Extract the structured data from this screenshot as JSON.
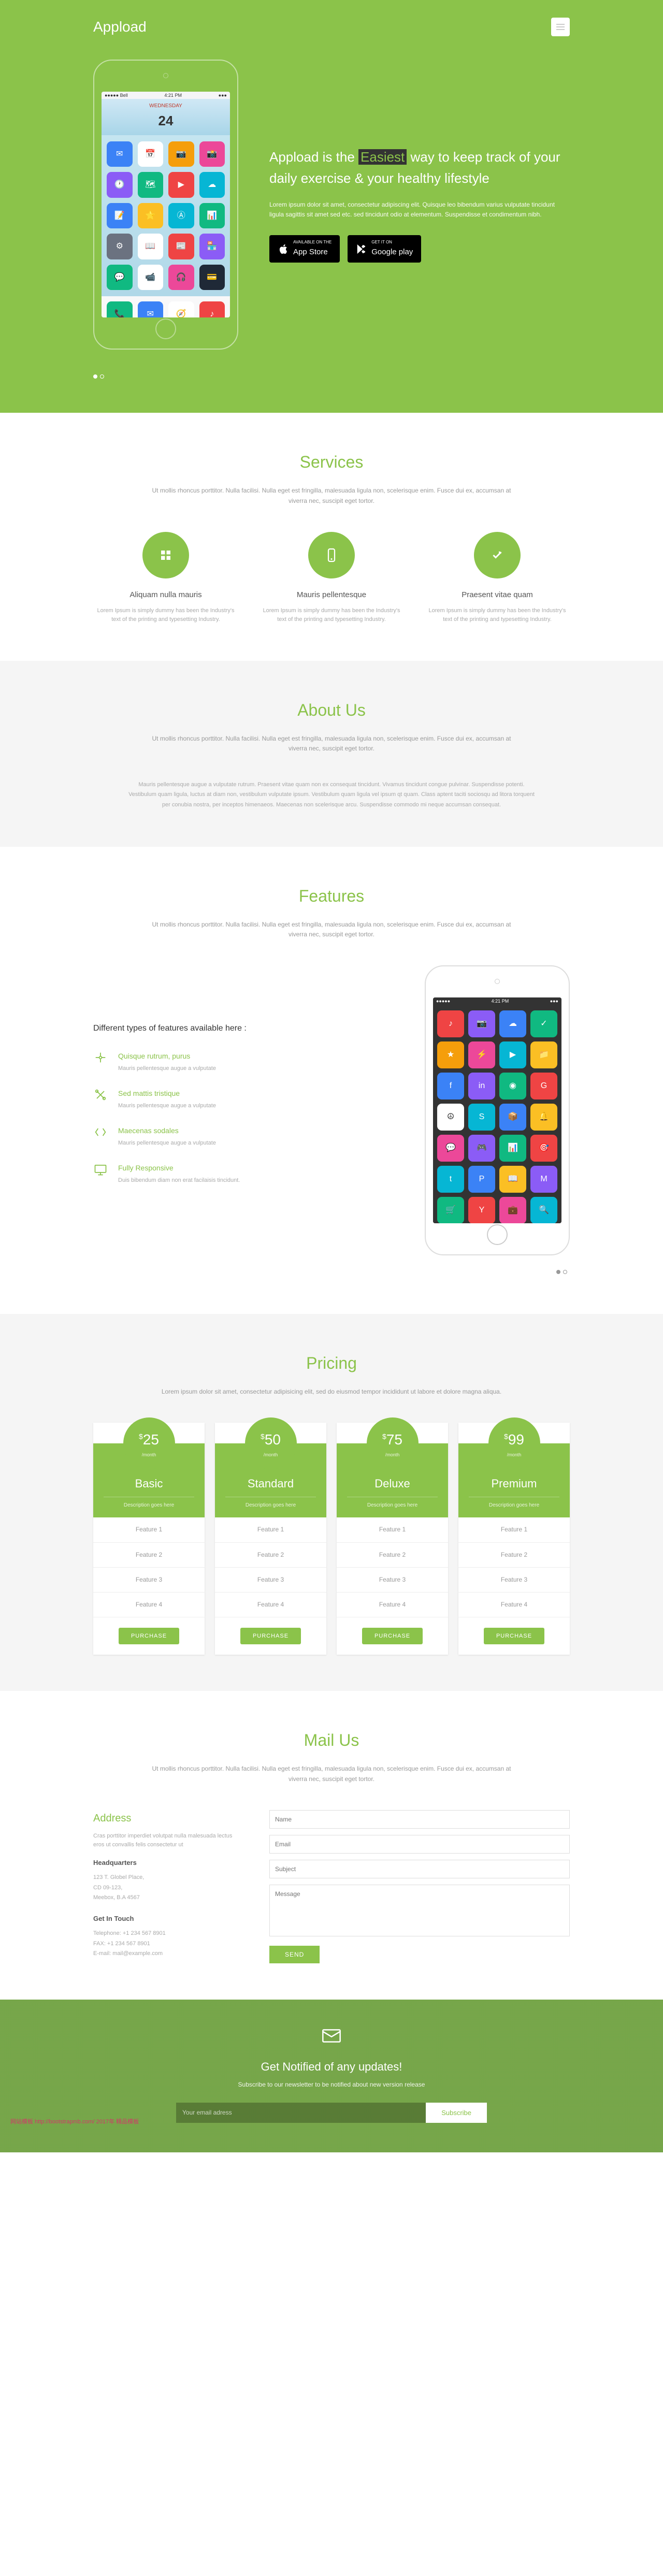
{
  "nav": {
    "logo": "Appload"
  },
  "hero": {
    "title_pre": "Appload is the ",
    "title_em": "Easiest",
    "title_post": " way to keep track of your daily exercise & your healthy lifestyle",
    "desc": "Lorem ipsum dolor sit amet, consectetur adipiscing elit. Quisque leo bibendum varius vulputate tincidunt ligula sagittis sit amet sed etc. sed tincidunt odio at elementum. Suspendisse et condimentum nibh.",
    "appstore_small": "AVAILABLE ON THE",
    "appstore_big": "App Store",
    "play_small": "GET IT ON",
    "play_big": "Google play",
    "phone": {
      "carrier": "●●●●● Bell",
      "time": "4:21 PM",
      "day": "WEDNESDAY",
      "date": "24"
    }
  },
  "services": {
    "title": "Services",
    "sub": "Ut mollis rhoncus porttitor. Nulla facilisi. Nulla eget est fringilla, malesuada ligula non, scelerisque enim. Fusce dui ex, accumsan at viverra nec, suscipit eget tortor.",
    "items": [
      {
        "title": "Aliquam nulla mauris",
        "desc": "Lorem Ipsum is simply dummy has been the Industry's text of the printing and typesetting Industry."
      },
      {
        "title": "Mauris pellentesque",
        "desc": "Lorem Ipsum is simply dummy has been the Industry's text of the printing and typesetting Industry."
      },
      {
        "title": "Praesent vitae quam",
        "desc": "Lorem Ipsum is simply dummy has been the Industry's text of the printing and typesetting Industry."
      }
    ]
  },
  "about": {
    "title": "About Us",
    "sub": "Ut mollis rhoncus porttitor. Nulla facilisi. Nulla eget est fringilla, malesuada ligula non, scelerisque enim. Fusce dui ex, accumsan at viverra nec, suscipit eget tortor.",
    "body": "Mauris pellentesque augue a vulputate rutrum. Praesent vitae quam non ex consequat tincidunt. Vivamus tincidunt congue pulvinar. Suspendisse potenti. Vestibulum quam ligula, luctus at diam non, vestibulum vulputate ipsum. Vestibulum quam ligula vel ipsum qt quam. Class aptent taciti sociosqu ad litora torquent per conubia nostra, per inceptos himenaeos. Maecenas non scelerisque arcu. Suspendisse commodo mi neque accumsan consequat."
  },
  "features": {
    "title": "Features",
    "sub": "Ut mollis rhoncus porttitor. Nulla facilisi. Nulla eget est fringilla, malesuada ligula non, scelerisque enim. Fusce dui ex, accumsan at viverra nec, suscipit eget tortor.",
    "heading": "Different types of features available here :",
    "items": [
      {
        "title": "Quisque rutrum, purus",
        "desc": "Mauris pellentesque augue a vulputate"
      },
      {
        "title": "Sed mattis tristique",
        "desc": "Mauris pellentesque augue a vulputate"
      },
      {
        "title": "Maecenas sodales",
        "desc": "Mauris pellentesque augue a vulputate"
      },
      {
        "title": "Fully Responsive",
        "desc": "Duis bibendum diam non erat facilaisis tincidunt."
      }
    ]
  },
  "pricing": {
    "title": "Pricing",
    "sub": "Lorem ipsum dolor sit amet, consectetur adipisicing elit, sed do eiusmod tempor incididunt ut labore et dolore magna aliqua.",
    "plan_desc": "Description goes here",
    "purchase": "PURCHASE",
    "plans": [
      {
        "price": "25",
        "per": "/month",
        "name": "Basic",
        "features": [
          "Feature 1",
          "Feature 2",
          "Feature 3",
          "Feature 4"
        ]
      },
      {
        "price": "50",
        "per": "/month",
        "name": "Standard",
        "features": [
          "Feature 1",
          "Feature 2",
          "Feature 3",
          "Feature 4"
        ]
      },
      {
        "price": "75",
        "per": "/month",
        "name": "Deluxe",
        "features": [
          "Feature 1",
          "Feature 2",
          "Feature 3",
          "Feature 4"
        ]
      },
      {
        "price": "99",
        "per": "/month",
        "name": "Premium",
        "features": [
          "Feature 1",
          "Feature 2",
          "Feature 3",
          "Feature 4"
        ]
      }
    ]
  },
  "mail": {
    "title": "Mail Us",
    "sub": "Ut mollis rhoncus porttitor. Nulla facilisi. Nulla eget est fringilla, malesuada ligula non, scelerisque enim. Fusce dui ex, accumsan at viverra nec, suscipit eget tortor.",
    "address_title": "Address",
    "address_desc": "Cras porttitor imperdiet volutpat nulla malesuada lectus eros ut convallis felis consectetur ut",
    "hq": "Headquarters",
    "hq_lines": "123 T. Globel Place,\nCD 09-123,\nMeebox, B.A 4567",
    "touch": "Get In Touch",
    "touch_lines": "Telephone: +1 234 567 8901\nFAX: +1 234 567 8901\nE-mail: mail@example.com",
    "ph_name": "Name",
    "ph_email": "Email",
    "ph_subject": "Subject",
    "ph_message": "Message",
    "send": "SEND"
  },
  "newsletter": {
    "title": "Get Notified of any updates!",
    "sub": "Subscribe to our newsletter to be notified about new version release",
    "placeholder": "Your email adress",
    "button": "Subscribe"
  },
  "watermark": "网站模板 http://bootstrapmb.com/ 2017年 精品模板"
}
